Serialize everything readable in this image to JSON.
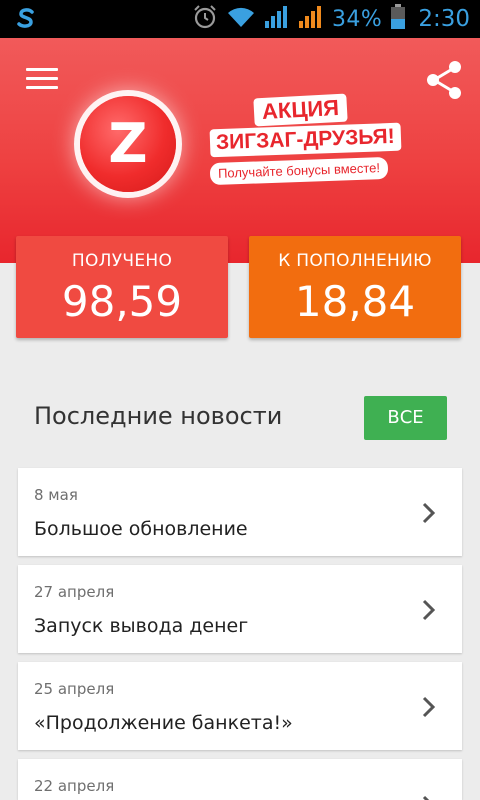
{
  "status_bar": {
    "app_icon": "s-icon",
    "battery_percent": "34%",
    "time": "2:30",
    "icons": [
      "alarm-icon",
      "wifi-icon",
      "signal-icon",
      "signal-roaming-icon",
      "battery-icon"
    ]
  },
  "header": {
    "menu_icon": "menu-icon",
    "share_icon": "share-icon",
    "logo_letter": "Z",
    "promo": {
      "line1": "АКЦИЯ",
      "line2": "ЗИГЗАГ-ДРУЗЬЯ!",
      "line3": "Получайте бонусы вместе!"
    },
    "colors": {
      "header_red": "#ee4141",
      "logo_red": "#f02c2c"
    }
  },
  "stats": [
    {
      "label": "ПОЛУЧЕНО",
      "value": "98,59",
      "color": "#f04a41"
    },
    {
      "label": "К ПОПОЛНЕНИЮ",
      "value": "18,84",
      "color": "#f26d0f"
    }
  ],
  "news": {
    "title": "Последние новости",
    "all_button": "ВСЕ",
    "all_button_color": "#3fb052",
    "items": [
      {
        "date": "8 мая",
        "headline": "Большое обновление"
      },
      {
        "date": "27 апреля",
        "headline": "Запуск вывода денег"
      },
      {
        "date": "25 апреля",
        "headline": "«Продолжение банкета!»"
      },
      {
        "date": "22 апреля",
        "headline": ""
      }
    ]
  }
}
